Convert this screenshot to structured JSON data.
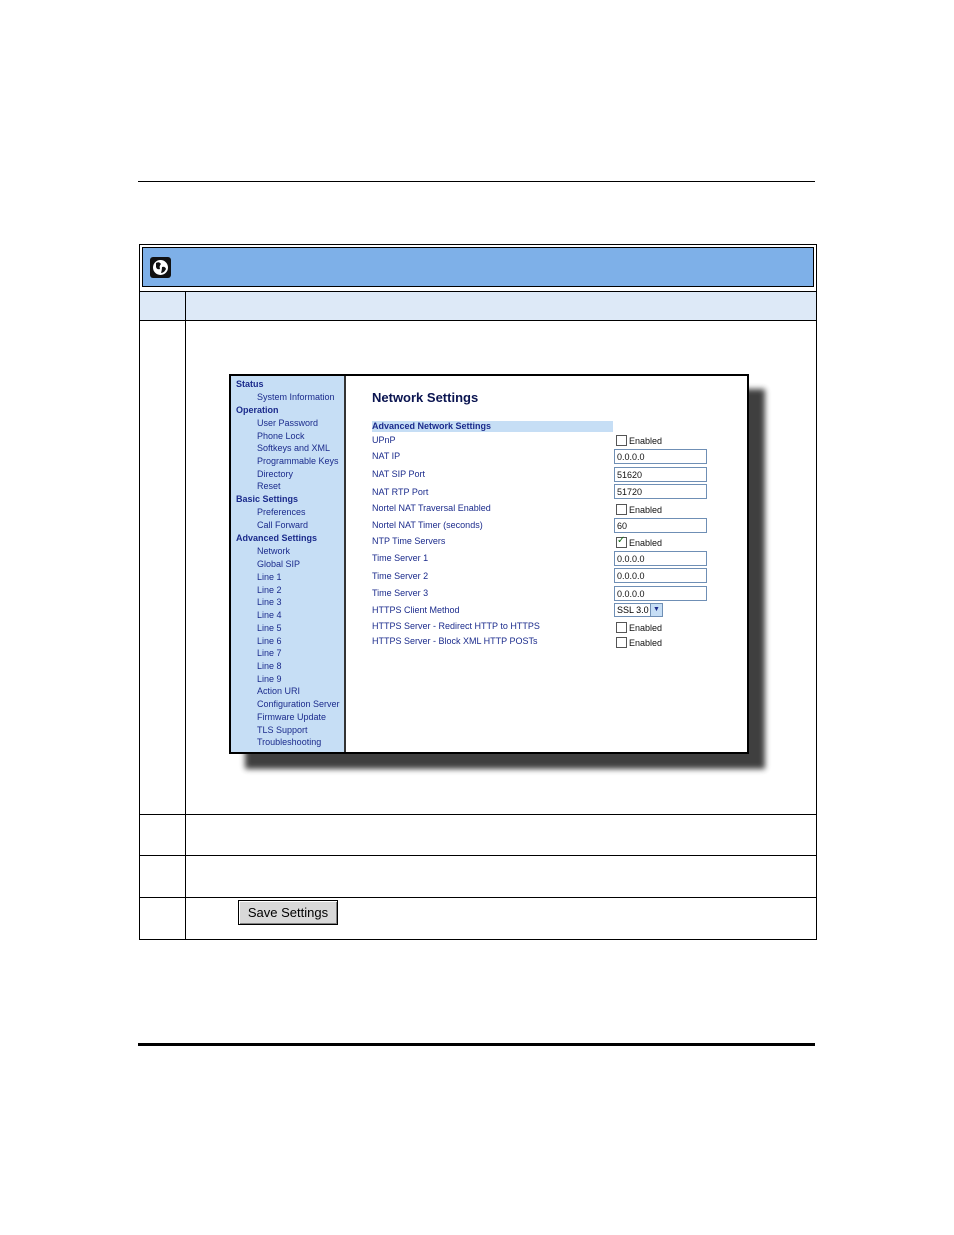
{
  "nav": {
    "sections": [
      {
        "label": "Status",
        "items": [
          "System Information"
        ]
      },
      {
        "label": "Operation",
        "items": [
          "User Password",
          "Phone Lock",
          "Softkeys and XML",
          "Programmable Keys",
          "Directory",
          "Reset"
        ]
      },
      {
        "label": "Basic Settings",
        "items": [
          "Preferences",
          "Call Forward"
        ]
      },
      {
        "label": "Advanced Settings",
        "items": [
          "Network",
          "Global SIP",
          "Line 1",
          "Line 2",
          "Line 3",
          "Line 4",
          "Line 5",
          "Line 6",
          "Line 7",
          "Line 8",
          "Line 9",
          "Action URI",
          "Configuration Server",
          "Firmware Update",
          "TLS Support",
          "Troubleshooting"
        ]
      }
    ]
  },
  "page": {
    "title": "Network Settings",
    "subheading": "Advanced Network Settings"
  },
  "fields": {
    "upnp": {
      "label": "UPnP",
      "checkbox_label": "Enabled",
      "checked": false
    },
    "nat_ip": {
      "label": "NAT IP",
      "value": "0.0.0.0"
    },
    "nat_sip_port": {
      "label": "NAT SIP Port",
      "value": "51620"
    },
    "nat_rtp_port": {
      "label": "NAT RTP Port",
      "value": "51720"
    },
    "nortel_nat_traversal": {
      "label": "Nortel NAT Traversal Enabled",
      "checkbox_label": "Enabled",
      "checked": false
    },
    "nortel_nat_timer": {
      "label": "Nortel NAT Timer (seconds)",
      "value": "60"
    },
    "ntp_time_servers": {
      "label": "NTP Time Servers",
      "checkbox_label": "Enabled",
      "checked": true
    },
    "time_server_1": {
      "label": "Time Server 1",
      "value": "0.0.0.0"
    },
    "time_server_2": {
      "label": "Time Server 2",
      "value": "0.0.0.0"
    },
    "time_server_3": {
      "label": "Time Server 3",
      "value": "0.0.0.0"
    },
    "https_client_method": {
      "label": "HTTPS Client Method",
      "value": "SSL 3.0"
    },
    "https_redirect": {
      "label": "HTTPS Server - Redirect HTTP to HTTPS",
      "checkbox_label": "Enabled",
      "checked": false
    },
    "https_block_xml": {
      "label": "HTTPS Server - Block XML HTTP POSTs",
      "checkbox_label": "Enabled",
      "checked": false
    }
  },
  "save_button": {
    "label": "Save Settings"
  },
  "icons": {
    "header": "globe-icon"
  },
  "colors": {
    "header_bar": "#7eb0e8",
    "nav_bg": "#c6def5",
    "nav_text": "#1b2b8c"
  }
}
